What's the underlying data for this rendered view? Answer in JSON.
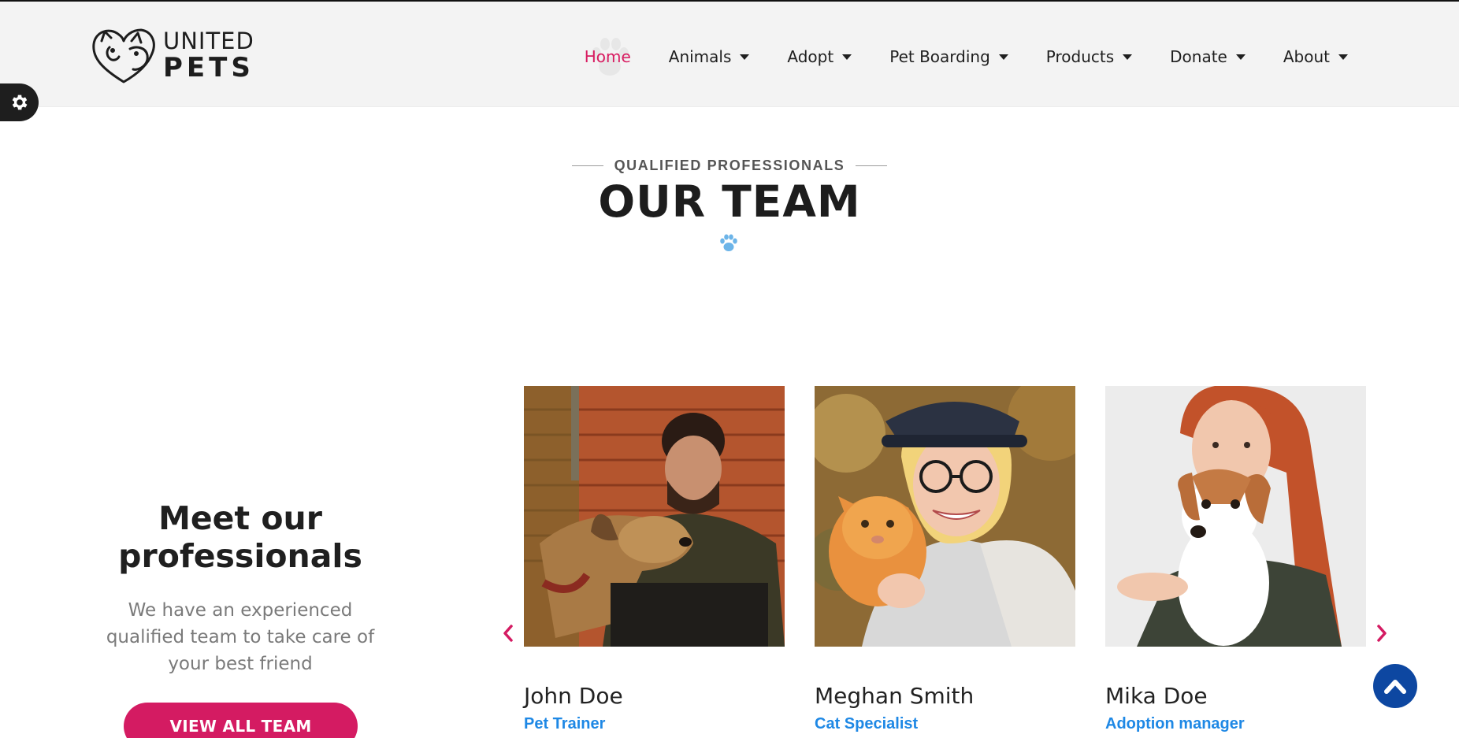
{
  "brand": {
    "line1": "UNITED",
    "line2": "PETS"
  },
  "nav": {
    "items": [
      {
        "label": "Home",
        "active": true,
        "dropdown": false
      },
      {
        "label": "Animals",
        "dropdown": true
      },
      {
        "label": "Adopt",
        "dropdown": true
      },
      {
        "label": "Pet Boarding",
        "dropdown": true
      },
      {
        "label": "Products",
        "dropdown": true
      },
      {
        "label": "Donate",
        "dropdown": true
      },
      {
        "label": "About",
        "dropdown": true
      }
    ]
  },
  "section": {
    "eyebrow": "QUALIFIED PROFESSIONALS",
    "title": "OUR TEAM"
  },
  "intro": {
    "title": "Meet our professionals",
    "text": "We have an experienced qualified team to take care of your best friend",
    "button": "VIEW ALL TEAM"
  },
  "team": [
    {
      "name": "John Doe",
      "role": "Pet Trainer"
    },
    {
      "name": "Meghan Smith",
      "role": "Cat Specialist"
    },
    {
      "name": "Mika Doe",
      "role": "Adoption manager"
    }
  ],
  "colors": {
    "accent": "#d41b62",
    "role": "#1e88e5",
    "scroll_top": "#0d47a1",
    "header_bg": "#f3f3f3"
  },
  "icons": {
    "settings": "gear-icon",
    "prev": "chevron-left-icon",
    "next": "chevron-right-icon",
    "to_top": "chevron-up-icon",
    "paw": "paw-icon"
  }
}
